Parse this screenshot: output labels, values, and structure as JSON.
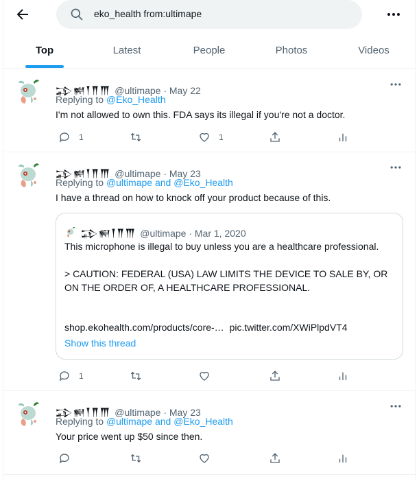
{
  "search": {
    "query": "eko_health from:ultimape"
  },
  "tabs": [
    "Top",
    "Latest",
    "People",
    "Photos",
    "Videos"
  ],
  "tweets": [
    {
      "display_name": "𒁉𒆍𒐕𒐖𒐗",
      "handle": "@ultimape",
      "date": "May 22",
      "replying_prefix": "Replying to",
      "replying_to": "@Eko_Health",
      "text": "I'm not allowed to own this. FDA says its illegal if you're not a doctor.",
      "reply_count": "1",
      "retweet_count": "",
      "like_count": "1"
    },
    {
      "display_name": "𒁉𒆍𒐕𒐖𒐗",
      "handle": "@ultimape",
      "date": "May 23",
      "replying_prefix": "Replying to",
      "replying_to": "@ultimape and @Eko_Health",
      "text": "I have a thread on how to knock off your product because of this.",
      "reply_count": "1",
      "retweet_count": "",
      "like_count": "",
      "quote": {
        "display_name": "𒁉𒆍𒐕𒐖𒐗",
        "handle": "@ultimape",
        "date": "Mar 1, 2020",
        "line1": "This microphone is illegal to buy unless you are a healthcare professional.",
        "line2": "> CAUTION: FEDERAL (USA) LAW LIMITS THE DEVICE TO SALE BY, OR ON THE ORDER OF, A HEALTHCARE PROFESSIONAL.",
        "link1": "shop.ekohealth.com/products/core-…",
        "link2": "pic.twitter.com/XWiPlpdVT4",
        "show_thread": "Show this thread"
      }
    },
    {
      "display_name": "𒁉𒆍𒐕𒐖𒐗",
      "handle": "@ultimape",
      "date": "May 23",
      "replying_prefix": "Replying to",
      "replying_to": "@ultimape and @Eko_Health",
      "text": "Your price went up $50 since then.",
      "reply_count": "",
      "retweet_count": "",
      "like_count": ""
    }
  ],
  "separator": " · ",
  "colors": {
    "accent": "#1d9bf0",
    "muted": "#536471",
    "text": "#0f1419",
    "border": "#eff3f4"
  }
}
